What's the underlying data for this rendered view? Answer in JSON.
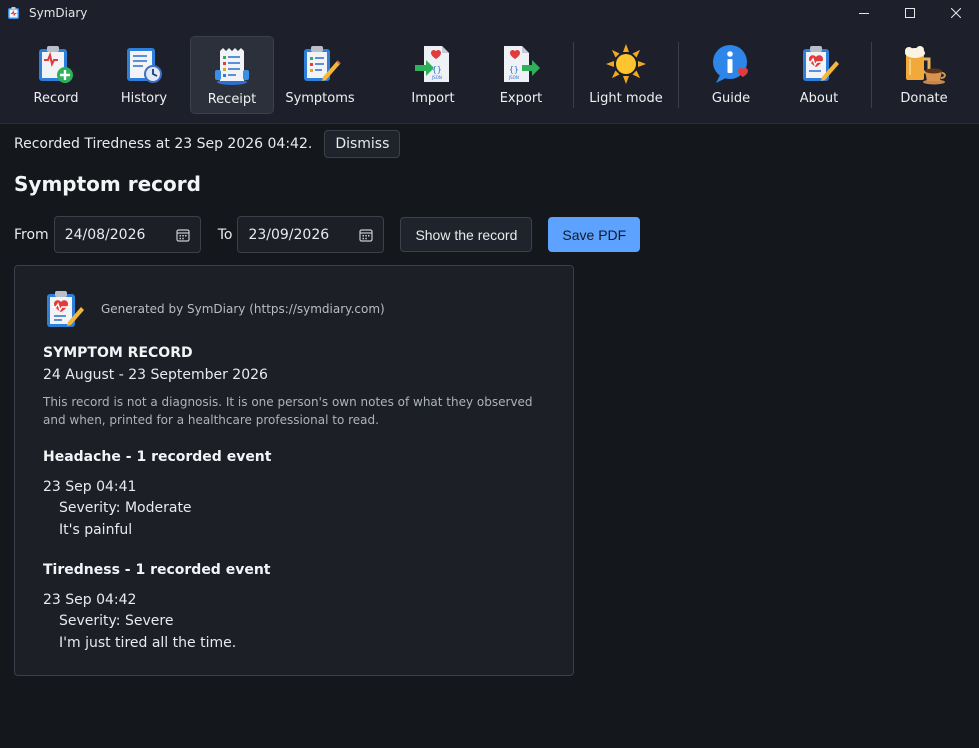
{
  "window": {
    "title": "SymDiary"
  },
  "toolbar": {
    "items": [
      {
        "label": "Record",
        "icon": "record-clipboard-plus-icon"
      },
      {
        "label": "History",
        "icon": "history-clipboard-clock-icon"
      },
      {
        "label": "Receipt",
        "icon": "receipt-icon",
        "active": true
      },
      {
        "label": "Symptoms",
        "icon": "symptoms-clipboard-pencil-icon"
      },
      {
        "label": "Import",
        "icon": "import-document-icon"
      },
      {
        "label": "Export",
        "icon": "export-document-icon"
      },
      {
        "label": "Light mode",
        "icon": "sun-icon"
      },
      {
        "label": "Guide",
        "icon": "info-bubble-icon"
      },
      {
        "label": "About",
        "icon": "about-clipboard-heart-icon"
      },
      {
        "label": "Donate",
        "icon": "beer-coffee-icon"
      }
    ]
  },
  "notice": {
    "text": "Recorded Tiredness at 23 Sep 2026 04:42.",
    "dismiss_label": "Dismiss"
  },
  "page": {
    "title": "Symptom record"
  },
  "filters": {
    "from_label": "From",
    "from_value": "24/08/2026",
    "to_label": "To",
    "to_value": "23/09/2026",
    "show_label": "Show the record",
    "save_label": "Save PDF"
  },
  "report": {
    "generated_by": "Generated by SymDiary (https://symdiary.com)",
    "title": "SYMPTOM RECORD",
    "range": "24 August - 23 September 2026",
    "disclaimer": "This record is not a diagnosis. It is one person's own notes of what they observed and when, printed for a healthcare professional to read.",
    "symptoms": [
      {
        "heading": "Headache - 1 recorded event",
        "time": "23 Sep 04:41",
        "severity": "Severity: Moderate",
        "note": "It's painful"
      },
      {
        "heading": "Tiredness - 1 recorded event",
        "time": "23 Sep 04:42",
        "severity": "Severity: Severe",
        "note": "I'm just tired all the time."
      }
    ]
  },
  "colors": {
    "accent": "#5ea2ff",
    "background": "#14171c",
    "toolbar": "#1d202b"
  }
}
